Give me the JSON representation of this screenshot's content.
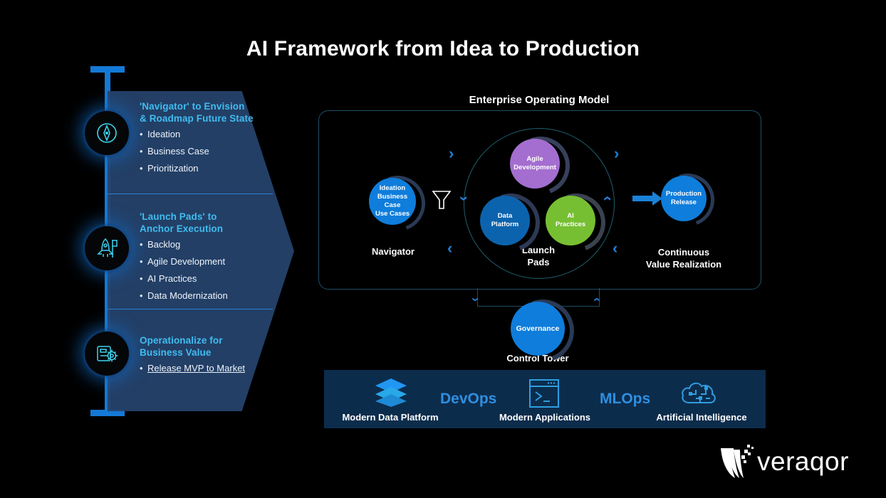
{
  "title": "AI Framework from Idea to Production",
  "sidebar": {
    "sections": [
      {
        "icon": "compass-icon",
        "heading": "'Navigator' to Envision\n& Roadmap Future State",
        "heading_line1": "'Navigator' to Envision",
        "heading_line2": "& Roadmap Future State",
        "bullets": [
          "Ideation",
          "Business Case",
          "Prioritization"
        ]
      },
      {
        "icon": "rocket-launch-icon",
        "heading_line1": "'Launch Pads' to",
        "heading_line2": "Anchor Execution",
        "bullets": [
          "Backlog",
          "Agile Development",
          "AI Practices",
          "Data Modernization"
        ]
      },
      {
        "icon": "device-gear-icon",
        "heading_line1": "Operationalize for",
        "heading_line2": "Business Value",
        "bullets": [
          "Release MVP to Market"
        ]
      }
    ]
  },
  "diagram": {
    "title": "Enterprise Operating Model",
    "nodes": {
      "navigator": {
        "label_lines": [
          "Ideation",
          "Business Case",
          "Use Cases"
        ],
        "caption": "Navigator",
        "color": "#0f7ddb"
      },
      "agile": {
        "label_lines": [
          "Agile",
          "Development"
        ],
        "color": "#a46ed0"
      },
      "data_platform": {
        "label_lines": [
          "Data",
          "Platform"
        ],
        "color": "#0c63ad"
      },
      "ai_practices": {
        "label_lines": [
          "AI",
          "Practices"
        ],
        "color": "#77bf32"
      },
      "launch_pads": {
        "caption_line1": "Launch",
        "caption_line2": "Pads"
      },
      "production": {
        "label_lines": [
          "Production",
          "Release"
        ],
        "caption_line1": "Continuous",
        "caption_line2": "Value Realization",
        "color": "#0f7ddb"
      },
      "governance": {
        "label": "Governance",
        "caption": "Control Tower",
        "color": "#0f7ddb"
      }
    },
    "icons": {
      "funnel": "funnel-icon",
      "arrow": "arrow-right-icon"
    }
  },
  "capabilities": [
    {
      "icon": "layers-stack-icon",
      "word": "",
      "label": "Modern Data Platform"
    },
    {
      "icon": "",
      "word": "DevOps",
      "label": ""
    },
    {
      "icon": "terminal-window-icon",
      "word": "",
      "label": "Modern Applications"
    },
    {
      "icon": "",
      "word": "MLOps",
      "label": ""
    },
    {
      "icon": "ai-cloud-chip-icon",
      "word": "",
      "label": "Artificial Intelligence"
    }
  ],
  "capability_labels": [
    "Modern Data Platform",
    "Modern Applications",
    "Artificial Intelligence"
  ],
  "capability_words": [
    "DevOps",
    "MLOps"
  ],
  "brand": {
    "name": "veraqor",
    "logo": "veraqor-logo"
  },
  "colors": {
    "accent_blue": "#1479d6",
    "cyan": "#3fbdf0",
    "panel": "#26446e",
    "capbar": "#0c2c4c",
    "purple": "#a46ed0",
    "green": "#77bf32",
    "deep_blue": "#0c63ad"
  }
}
